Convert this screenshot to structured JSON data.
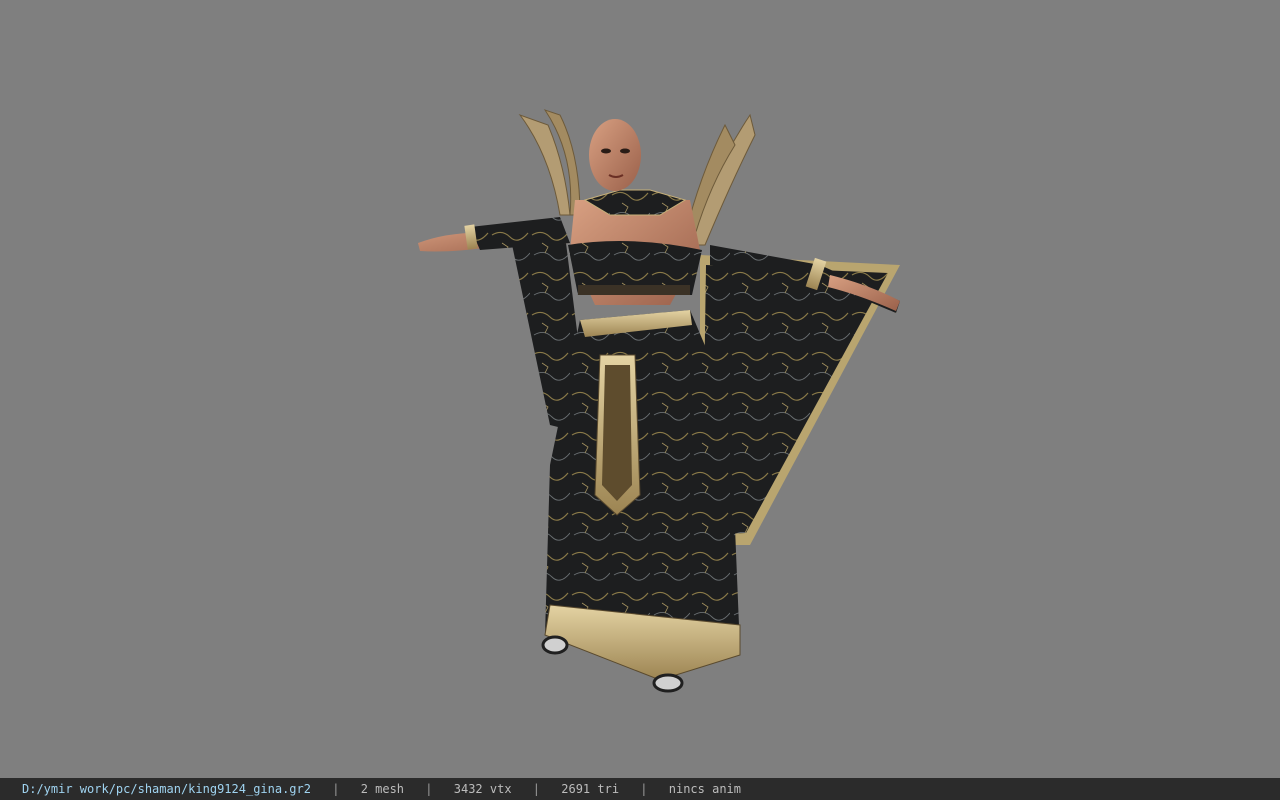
{
  "viewer": {
    "background_color": "#7f7f7f",
    "model_name": "shaman character model"
  },
  "status_bar": {
    "file_path": "D:/ymir work/pc/shaman/king9124_gina.gr2",
    "separator": "|",
    "mesh": "2 mesh",
    "vertices": "3432 vtx",
    "triangles": "2691 tri",
    "animation": "nincs anim",
    "path_color": "#9fd3f0",
    "text_color": "#bcbcbc"
  }
}
